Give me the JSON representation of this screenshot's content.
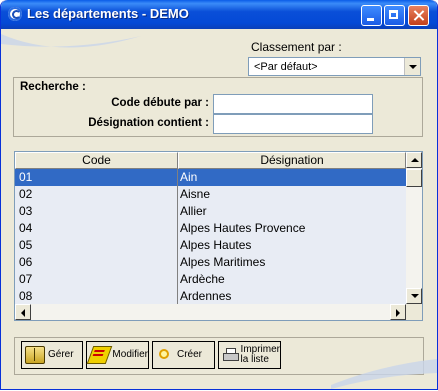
{
  "window": {
    "title": "Les départements - DEMO"
  },
  "sort": {
    "label": "Classement par :",
    "selected": "<Par défaut>"
  },
  "search": {
    "title": "Recherche :",
    "code_label": "Code débute par :",
    "code_value": "",
    "designation_label": "Désignation contient :",
    "designation_value": ""
  },
  "grid": {
    "columns": [
      "Code",
      "Désignation"
    ],
    "rows": [
      {
        "code": "01",
        "designation": "Ain"
      },
      {
        "code": "02",
        "designation": "Aisne"
      },
      {
        "code": "03",
        "designation": "Allier"
      },
      {
        "code": "04",
        "designation": "Alpes Hautes Provence"
      },
      {
        "code": "05",
        "designation": "Alpes Hautes"
      },
      {
        "code": "06",
        "designation": "Alpes Maritimes"
      },
      {
        "code": "07",
        "designation": "Ardèche"
      },
      {
        "code": "08",
        "designation": "Ardennes"
      }
    ],
    "selected_row": 0
  },
  "toolbar": {
    "manage_label": "Gérer",
    "modify_label": "Modifier",
    "create_label": "Créer",
    "print_label_line1": "Imprimer",
    "print_label_line2": "la liste"
  },
  "colors": {
    "titlebar": "#0a4fd8",
    "selection": "#316ac5",
    "face": "#ece9d8"
  }
}
